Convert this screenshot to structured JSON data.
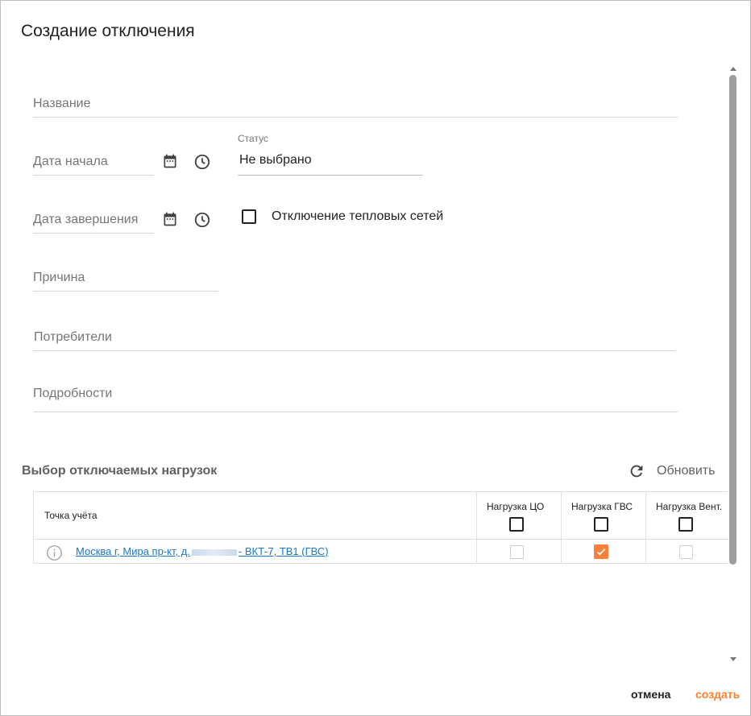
{
  "dialog": {
    "title": "Создание отключения"
  },
  "form": {
    "name_placeholder": "Название",
    "start_date_placeholder": "Дата начала",
    "end_date_placeholder": "Дата завершения",
    "status_label": "Статус",
    "status_value": "Не выбрано",
    "heat_network_checkbox_label": "Отключение тепловых сетей",
    "heat_network_checked": false,
    "reason_placeholder": "Причина",
    "consumers_placeholder": "Потребители",
    "details_placeholder": "Подробности"
  },
  "loads": {
    "section_title": "Выбор отключаемых нагрузок",
    "refresh_label": "Обновить",
    "columns": [
      "Точка учёта",
      "Нагрузка ЦО",
      "Нагрузка ГВС",
      "Нагрузка Вент."
    ],
    "rows": [
      {
        "point_prefix": "Москва г, Мира пр-кт, д.",
        "point_suffix": "- ВКТ-7, ТВ1 (ГВС)",
        "load_co": false,
        "load_gvs": true,
        "load_vent": false
      }
    ]
  },
  "actions": {
    "cancel_label": "отмена",
    "create_label": "создать"
  },
  "colors": {
    "accent": "#ff7f2a",
    "link": "#1976d2"
  }
}
